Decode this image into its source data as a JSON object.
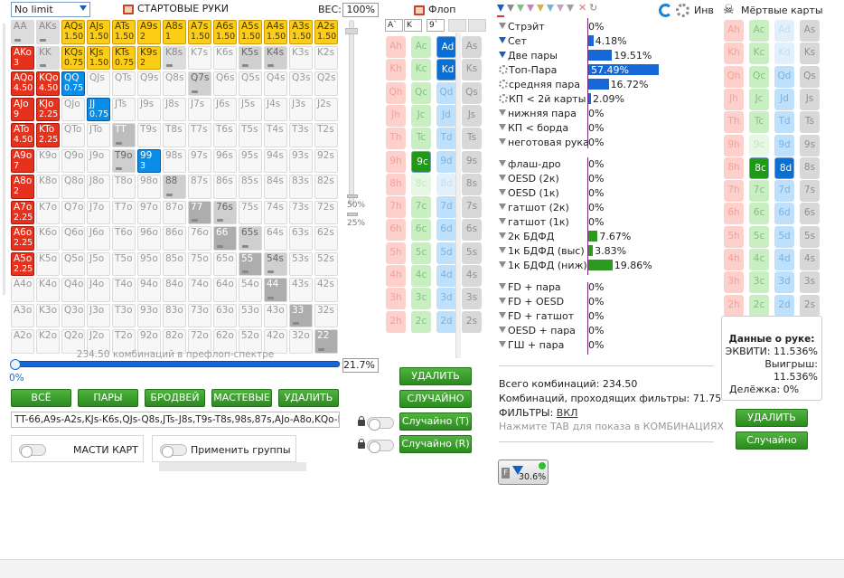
{
  "header": {
    "game_select": "No limit",
    "start_hands_title": "СТАРТОВЫЕ РУКИ",
    "weight_label": "ВЕС:",
    "weight_value": "100%",
    "flop_title": "Флоп",
    "inv_label": "Инв",
    "dead_cards_title": "Мёртвые карты"
  },
  "board_slots": [
    "A`",
    "K",
    "9`",
    "",
    ""
  ],
  "hand_grid": [
    [
      [
        "AA",
        "",
        "g1"
      ],
      [
        "AKs",
        "",
        "g1"
      ],
      [
        "AQs",
        "1.50",
        "y"
      ],
      [
        "AJs",
        "1.50",
        "y"
      ],
      [
        "ATs",
        "1.50",
        "y"
      ],
      [
        "A9s",
        "2",
        "y"
      ],
      [
        "A8s",
        "1",
        "y"
      ],
      [
        "A7s",
        "1.50",
        "y"
      ],
      [
        "A6s",
        "1.50",
        "y"
      ],
      [
        "A5s",
        "1.50",
        "y"
      ],
      [
        "A4s",
        "1.50",
        "y"
      ],
      [
        "A3s",
        "1.50",
        "y"
      ],
      [
        "A2s",
        "1.50",
        "y"
      ]
    ],
    [
      [
        "AKo",
        "3",
        "r"
      ],
      [
        "KK",
        "",
        "g1"
      ],
      [
        "KQs",
        "0.75",
        "y"
      ],
      [
        "KJs",
        "1.50",
        "y"
      ],
      [
        "KTs",
        "0.75",
        "y"
      ],
      [
        "K9s",
        "2",
        "y"
      ],
      [
        "K8s",
        "",
        "g1"
      ],
      [
        "K7s",
        "",
        "wh"
      ],
      [
        "K6s",
        "",
        "wh"
      ],
      [
        "K5s",
        "",
        "g2"
      ],
      [
        "K4s",
        "",
        "g2"
      ],
      [
        "K3s",
        "",
        "wh"
      ],
      [
        "K2s",
        "",
        "wh"
      ]
    ],
    [
      [
        "AQo",
        "4.50",
        "r"
      ],
      [
        "KQo",
        "4.50",
        "r"
      ],
      [
        "QQ",
        "0.75",
        "b"
      ],
      [
        "QJs",
        "",
        "wh"
      ],
      [
        "QTs",
        "",
        "wh"
      ],
      [
        "Q9s",
        "",
        "wh"
      ],
      [
        "Q8s",
        "",
        "wh"
      ],
      [
        "Q7s",
        "",
        "g2"
      ],
      [
        "Q6s",
        "",
        "wh"
      ],
      [
        "Q5s",
        "",
        "wh"
      ],
      [
        "Q4s",
        "",
        "wh"
      ],
      [
        "Q3s",
        "",
        "wh"
      ],
      [
        "Q2s",
        "",
        "wh"
      ]
    ],
    [
      [
        "AJo",
        "9",
        "r"
      ],
      [
        "KJo",
        "2.25",
        "r"
      ],
      [
        "QJo",
        "",
        "wh"
      ],
      [
        "JJ",
        "0.75",
        "b"
      ],
      [
        "JTs",
        "",
        "wh"
      ],
      [
        "J9s",
        "",
        "wh"
      ],
      [
        "J8s",
        "",
        "wh"
      ],
      [
        "J7s",
        "",
        "wh"
      ],
      [
        "J6s",
        "",
        "wh"
      ],
      [
        "J5s",
        "",
        "wh"
      ],
      [
        "J4s",
        "",
        "wh"
      ],
      [
        "J3s",
        "",
        "wh"
      ],
      [
        "J2s",
        "",
        "wh"
      ]
    ],
    [
      [
        "ATo",
        "4.50",
        "r"
      ],
      [
        "KTo",
        "2.25",
        "r"
      ],
      [
        "QTo",
        "",
        "wh"
      ],
      [
        "JTo",
        "",
        "wh"
      ],
      [
        "TT",
        "",
        "g3"
      ],
      [
        "T9s",
        "",
        "wh"
      ],
      [
        "T8s",
        "",
        "wh"
      ],
      [
        "T7s",
        "",
        "wh"
      ],
      [
        "T6s",
        "",
        "wh"
      ],
      [
        "T5s",
        "",
        "wh"
      ],
      [
        "T4s",
        "",
        "wh"
      ],
      [
        "T3s",
        "",
        "wh"
      ],
      [
        "T2s",
        "",
        "wh"
      ]
    ],
    [
      [
        "A9o",
        "7",
        "r"
      ],
      [
        "K9o",
        "",
        "wh"
      ],
      [
        "Q9o",
        "",
        "wh"
      ],
      [
        "J9o",
        "",
        "wh"
      ],
      [
        "T9o",
        "",
        "g2"
      ],
      [
        "99",
        "3",
        "b"
      ],
      [
        "98s",
        "",
        "wh"
      ],
      [
        "97s",
        "",
        "wh"
      ],
      [
        "96s",
        "",
        "wh"
      ],
      [
        "95s",
        "",
        "wh"
      ],
      [
        "94s",
        "",
        "wh"
      ],
      [
        "93s",
        "",
        "wh"
      ],
      [
        "92s",
        "",
        "wh"
      ]
    ],
    [
      [
        "A8o",
        "2",
        "r"
      ],
      [
        "K8o",
        "",
        "wh"
      ],
      [
        "Q8o",
        "",
        "wh"
      ],
      [
        "J8o",
        "",
        "wh"
      ],
      [
        "T8o",
        "",
        "wh"
      ],
      [
        "98o",
        "",
        "wh"
      ],
      [
        "88",
        "",
        "g2"
      ],
      [
        "87s",
        "",
        "wh"
      ],
      [
        "86s",
        "",
        "wh"
      ],
      [
        "85s",
        "",
        "wh"
      ],
      [
        "84s",
        "",
        "wh"
      ],
      [
        "83s",
        "",
        "wh"
      ],
      [
        "82s",
        "",
        "wh"
      ]
    ],
    [
      [
        "A7o",
        "2.25",
        "r"
      ],
      [
        "K7o",
        "",
        "wh"
      ],
      [
        "Q7o",
        "",
        "wh"
      ],
      [
        "J7o",
        "",
        "wh"
      ],
      [
        "T7o",
        "",
        "wh"
      ],
      [
        "97o",
        "",
        "wh"
      ],
      [
        "87o",
        "",
        "wh"
      ],
      [
        "77",
        "",
        "g4"
      ],
      [
        "76s",
        "",
        "g2"
      ],
      [
        "75s",
        "",
        "wh"
      ],
      [
        "74s",
        "",
        "wh"
      ],
      [
        "73s",
        "",
        "wh"
      ],
      [
        "72s",
        "",
        "wh"
      ]
    ],
    [
      [
        "A6o",
        "2.25",
        "r"
      ],
      [
        "K6o",
        "",
        "wh"
      ],
      [
        "Q6o",
        "",
        "wh"
      ],
      [
        "J6o",
        "",
        "wh"
      ],
      [
        "T6o",
        "",
        "wh"
      ],
      [
        "96o",
        "",
        "wh"
      ],
      [
        "86o",
        "",
        "wh"
      ],
      [
        "76o",
        "",
        "wh"
      ],
      [
        "66",
        "",
        "g4"
      ],
      [
        "65s",
        "",
        "g2"
      ],
      [
        "64s",
        "",
        "wh"
      ],
      [
        "63s",
        "",
        "wh"
      ],
      [
        "62s",
        "",
        "wh"
      ]
    ],
    [
      [
        "A5o",
        "2.25",
        "r"
      ],
      [
        "K5o",
        "",
        "wh"
      ],
      [
        "Q5o",
        "",
        "wh"
      ],
      [
        "J5o",
        "",
        "wh"
      ],
      [
        "T5o",
        "",
        "wh"
      ],
      [
        "95o",
        "",
        "wh"
      ],
      [
        "85o",
        "",
        "wh"
      ],
      [
        "75o",
        "",
        "wh"
      ],
      [
        "65o",
        "",
        "wh"
      ],
      [
        "55",
        "",
        "g4"
      ],
      [
        "54s",
        "",
        "g2"
      ],
      [
        "53s",
        "",
        "wh"
      ],
      [
        "52s",
        "",
        "wh"
      ]
    ],
    [
      [
        "A4o",
        "",
        "wh"
      ],
      [
        "K4o",
        "",
        "wh"
      ],
      [
        "Q4o",
        "",
        "wh"
      ],
      [
        "J4o",
        "",
        "wh"
      ],
      [
        "T4o",
        "",
        "wh"
      ],
      [
        "94o",
        "",
        "wh"
      ],
      [
        "84o",
        "",
        "wh"
      ],
      [
        "74o",
        "",
        "wh"
      ],
      [
        "64o",
        "",
        "wh"
      ],
      [
        "54o",
        "",
        "wh"
      ],
      [
        "44",
        "",
        "g4"
      ],
      [
        "43s",
        "",
        "wh"
      ],
      [
        "42s",
        "",
        "wh"
      ]
    ],
    [
      [
        "A3o",
        "",
        "wh"
      ],
      [
        "K3o",
        "",
        "wh"
      ],
      [
        "Q3o",
        "",
        "wh"
      ],
      [
        "J3o",
        "",
        "wh"
      ],
      [
        "T3o",
        "",
        "wh"
      ],
      [
        "93o",
        "",
        "wh"
      ],
      [
        "83o",
        "",
        "wh"
      ],
      [
        "73o",
        "",
        "wh"
      ],
      [
        "63o",
        "",
        "wh"
      ],
      [
        "53o",
        "",
        "wh"
      ],
      [
        "43o",
        "",
        "wh"
      ],
      [
        "33",
        "",
        "g4"
      ],
      [
        "32s",
        "",
        "wh"
      ]
    ],
    [
      [
        "A2o",
        "",
        "wh"
      ],
      [
        "K2o",
        "",
        "wh"
      ],
      [
        "Q2o",
        "",
        "wh"
      ],
      [
        "J2o",
        "",
        "wh"
      ],
      [
        "T2o",
        "",
        "wh"
      ],
      [
        "92o",
        "",
        "wh"
      ],
      [
        "82o",
        "",
        "wh"
      ],
      [
        "72o",
        "",
        "wh"
      ],
      [
        "62o",
        "",
        "wh"
      ],
      [
        "52o",
        "",
        "wh"
      ],
      [
        "42o",
        "",
        "wh"
      ],
      [
        "32o",
        "",
        "wh"
      ],
      [
        "22",
        "",
        "g4"
      ]
    ]
  ],
  "slider_labels": {
    "v50": "50%",
    "v25": "25%",
    "range_text": "234.50 комбинаций в префлоп-спектре",
    "range_pct": "21.7%",
    "zero_pct": "0%"
  },
  "range_buttons": [
    "ВСЁ",
    "ПАРЫ",
    "БРОДВЕЙ",
    "МАСТЕВЫЕ",
    "УДАЛИТЬ"
  ],
  "range_text": "TT-66,A9s-A2s,KJs-K6s,QJs-Q8s,JTs-J8s,T9s-T8s,98s,87s,AJo-A8o,KQo-KTo",
  "toggles": {
    "suits": "МАСТИ КАРТ",
    "groups": "Применить группы"
  },
  "flop_buttons": {
    "delete": "УДАЛИТЬ",
    "random": "СЛУЧАЙНО",
    "random_t": "Случайно (T)",
    "random_r": "Случайно (R)"
  },
  "flop_cards": [
    [
      "Ah",
      "Ac",
      "Ad",
      "As"
    ],
    [
      "Kh",
      "Kc",
      "Kd",
      "Ks"
    ],
    [
      "Qh",
      "Qc",
      "Qd",
      "Qs"
    ],
    [
      "Jh",
      "Jc",
      "Jd",
      "Js"
    ],
    [
      "Th",
      "Tc",
      "Td",
      "Ts"
    ],
    [
      "9h",
      "9c",
      "9d",
      "9s"
    ],
    [
      "8h",
      "8c",
      "8d",
      "8s"
    ],
    [
      "7h",
      "7c",
      "7d",
      "7s"
    ],
    [
      "6h",
      "6c",
      "6d",
      "6s"
    ],
    [
      "5h",
      "5c",
      "5d",
      "5s"
    ],
    [
      "4h",
      "4c",
      "4d",
      "4s"
    ],
    [
      "3h",
      "3c",
      "3d",
      "3s"
    ],
    [
      "2h",
      "2c",
      "2d",
      "2s"
    ]
  ],
  "stats": [
    {
      "label": "Стрэйт",
      "value": "0%",
      "blue": false,
      "cog": false,
      "bar": 0
    },
    {
      "label": "Сет",
      "value": "4.18%",
      "blue": true,
      "cog": false,
      "bar": 4.18
    },
    {
      "label": "Две пары",
      "value": "19.51%",
      "blue": true,
      "cog": false,
      "bar": 19.51
    },
    {
      "label": "Топ-Пара",
      "value": "57.49%",
      "blue": false,
      "cog": true,
      "bar": 57.49
    },
    {
      "label": "средняя пара",
      "value": "16.72%",
      "blue": false,
      "cog": true,
      "bar": 16.72
    },
    {
      "label": "КП < 2й карты",
      "value": "2.09%",
      "blue": false,
      "cog": true,
      "bar": 2.09
    },
    {
      "label": "нижняя пара",
      "value": "0%",
      "blue": false,
      "cog": false,
      "bar": 0
    },
    {
      "label": "КП < борда",
      "value": "0%",
      "blue": false,
      "cog": false,
      "bar": 0
    },
    {
      "label": "неготовая рука",
      "value": "0%",
      "blue": false,
      "cog": false,
      "bar": 0
    }
  ],
  "draws": [
    {
      "label": "флаш-дро",
      "value": "0%",
      "bar": 0
    },
    {
      "label": "OESD (2к)",
      "value": "0%",
      "bar": 0
    },
    {
      "label": "OESD (1к)",
      "value": "0%",
      "bar": 0
    },
    {
      "label": "гатшот (2к)",
      "value": "0%",
      "bar": 0
    },
    {
      "label": "гатшот (1к)",
      "value": "0%",
      "bar": 0
    },
    {
      "label": "2к БДФД",
      "value": "7.67%",
      "bar": 7.67
    },
    {
      "label": "1к БДФД (выс)",
      "value": "3.83%",
      "bar": 3.83
    },
    {
      "label": "1к БДФД (ниж)",
      "value": "19.86%",
      "bar": 19.86
    }
  ],
  "combos": [
    {
      "label": "FD + пара",
      "value": "0%"
    },
    {
      "label": "FD + OESD",
      "value": "0%"
    },
    {
      "label": "FD + гатшот",
      "value": "0%"
    },
    {
      "label": "OESD + пара",
      "value": "0%"
    },
    {
      "label": "ГШ + пара",
      "value": "0%"
    }
  ],
  "summary": {
    "total": "Всего комбинаций: 234.50",
    "passing": "Комбинаций, проходящих фильтры: 71.75",
    "filters_label": "ФИЛЬТРЫ:",
    "filters_value": "ВКЛ",
    "tab_hint": "Нажмите TAB для показа в КОМБИНАЦИЯХ",
    "filter_badge": "30.6%"
  },
  "hand_data": {
    "title": "Данные о руке:",
    "equity": "ЭКВИТИ: 11.536%",
    "win": "Выигрыш: 11.536%",
    "split": "Делёжка: 0%"
  },
  "dead_buttons": {
    "delete": "УДАЛИТЬ",
    "random": "Случайно"
  },
  "colors": {
    "accent_green": "#2c8a20",
    "raise_red": "#e6321d",
    "call_yellow": "#fbcd16",
    "pair_blue": "#0a8de8"
  }
}
